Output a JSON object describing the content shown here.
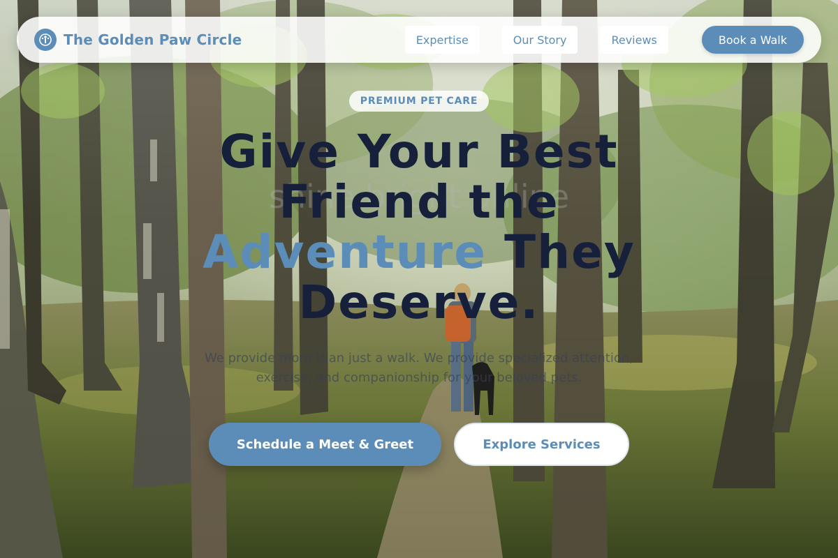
{
  "nav": {
    "brand_name": "The Golden Paw Circle",
    "brand_icon": "paw-circle-logo-icon",
    "links": [
      {
        "label": "Expertise"
      },
      {
        "label": "Our Story"
      },
      {
        "label": "Reviews"
      }
    ],
    "cta_label": "Book a Walk"
  },
  "hero": {
    "badge": "PREMIUM PET CARE",
    "headline_part1": "Give Your Best Friend the",
    "headline_accent": "Adventure",
    "headline_part2": "They Deserve.",
    "ghost_text": "shine bright online",
    "subtext": "We provide more than just a walk. We provide specialized attention, exercise, and companionship for your beloved pets.",
    "primary_cta": "Schedule a Meet & Greet",
    "secondary_cta": "Explore Services"
  },
  "colors": {
    "accent": "#5b8db8",
    "heading": "#17203a",
    "nav_background": "#ffffff"
  }
}
